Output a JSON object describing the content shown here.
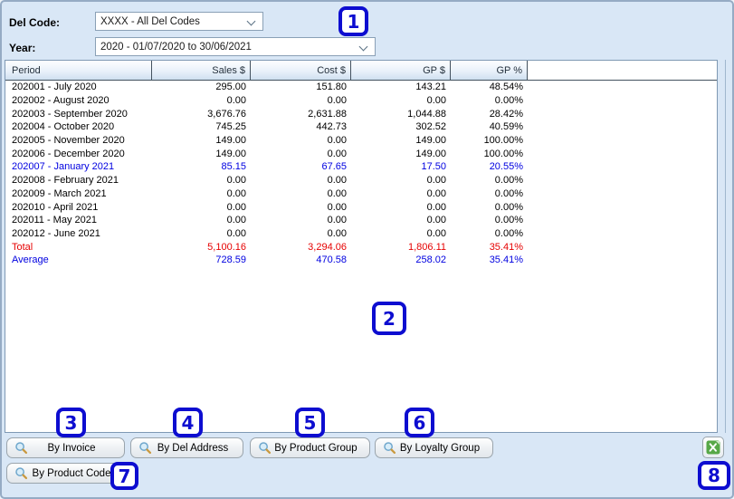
{
  "filters": {
    "del_code_label": "Del Code:",
    "del_code_value": "XXXX - All Del Codes",
    "year_label": "Year:",
    "year_value": "2020 - 01/07/2020 to 30/06/2021"
  },
  "table": {
    "columns": [
      {
        "label": "Period",
        "align": "left"
      },
      {
        "label": "Sales $",
        "align": "right"
      },
      {
        "label": "Cost $",
        "align": "right"
      },
      {
        "label": "GP $",
        "align": "right"
      },
      {
        "label": "GP %",
        "align": "right"
      }
    ],
    "rows": [
      {
        "style": "normal",
        "cells": [
          "202001 - July 2020",
          "295.00",
          "151.80",
          "143.21",
          "48.54%"
        ]
      },
      {
        "style": "normal",
        "cells": [
          "202002 - August 2020",
          "0.00",
          "0.00",
          "0.00",
          "0.00%"
        ]
      },
      {
        "style": "normal",
        "cells": [
          "202003 - September 2020",
          "3,676.76",
          "2,631.88",
          "1,044.88",
          "28.42%"
        ]
      },
      {
        "style": "normal",
        "cells": [
          "202004 - October 2020",
          "745.25",
          "442.73",
          "302.52",
          "40.59%"
        ]
      },
      {
        "style": "normal",
        "cells": [
          "202005 - November 2020",
          "149.00",
          "0.00",
          "149.00",
          "100.00%"
        ]
      },
      {
        "style": "normal",
        "cells": [
          "202006 - December 2020",
          "149.00",
          "0.00",
          "149.00",
          "100.00%"
        ]
      },
      {
        "style": "current",
        "cells": [
          "202007 - January 2021",
          "85.15",
          "67.65",
          "17.50",
          "20.55%"
        ]
      },
      {
        "style": "normal",
        "cells": [
          "202008 - February 2021",
          "0.00",
          "0.00",
          "0.00",
          "0.00%"
        ]
      },
      {
        "style": "normal",
        "cells": [
          "202009 - March 2021",
          "0.00",
          "0.00",
          "0.00",
          "0.00%"
        ]
      },
      {
        "style": "normal",
        "cells": [
          "202010 - April 2021",
          "0.00",
          "0.00",
          "0.00",
          "0.00%"
        ]
      },
      {
        "style": "normal",
        "cells": [
          "202011 - May 2021",
          "0.00",
          "0.00",
          "0.00",
          "0.00%"
        ]
      },
      {
        "style": "normal",
        "cells": [
          "202012 - June 2021",
          "0.00",
          "0.00",
          "0.00",
          "0.00%"
        ]
      },
      {
        "style": "total",
        "cells": [
          "Total",
          "5,100.16",
          "3,294.06",
          "1,806.11",
          "35.41%"
        ]
      },
      {
        "style": "average",
        "cells": [
          "Average",
          "728.59",
          "470.58",
          "258.02",
          "35.41%"
        ]
      }
    ]
  },
  "footer": {
    "buttons_row1": [
      {
        "label": "By Invoice",
        "icon": "magnifier-icon"
      },
      {
        "label": "By Del Address",
        "icon": "magnifier-icon"
      },
      {
        "label": "By Product Group",
        "icon": "magnifier-icon"
      },
      {
        "label": "By Loyalty Group",
        "icon": "magnifier-icon"
      }
    ],
    "buttons_row2": [
      {
        "label": "By Product Code",
        "icon": "magnifier-icon"
      }
    ],
    "export_button_icon": "excel-export-icon"
  },
  "annotations": [
    "1",
    "2",
    "3",
    "4",
    "5",
    "6",
    "7",
    "8"
  ],
  "icons": {
    "dropdown": "chevron-down-icon",
    "search": "magnifier-icon",
    "export": "excel-export-icon"
  },
  "colors": {
    "row_total": "#e60000",
    "row_highlight": "#0000e0",
    "annotation_blue": "#0d0dd0",
    "excel_green": "#57a847",
    "window_background": "#d9e7f6"
  }
}
